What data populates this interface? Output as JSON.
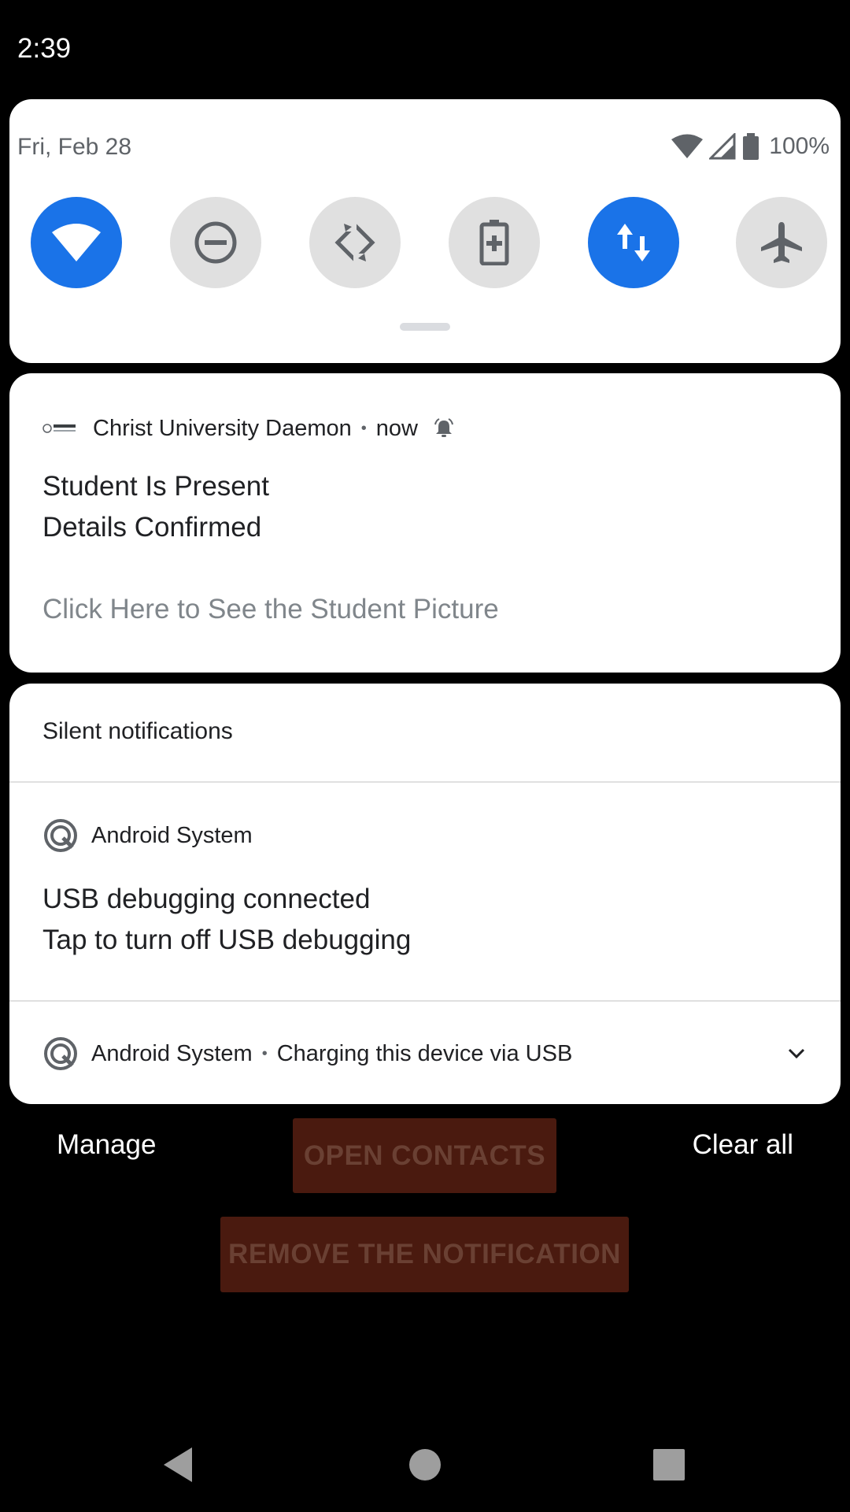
{
  "status_bar": {
    "time": "2:39"
  },
  "background_app": {
    "open_contacts_label": "OPEN CONTACTS",
    "remove_notification_label": "REMOVE THE NOTIFICATION"
  },
  "quick_settings": {
    "date": "Fri, Feb 28",
    "battery_percent": "100%",
    "tiles": [
      {
        "name": "wifi",
        "active": true
      },
      {
        "name": "do-not-disturb",
        "active": false
      },
      {
        "name": "auto-rotate",
        "active": false
      },
      {
        "name": "battery-saver",
        "active": false
      },
      {
        "name": "mobile-data",
        "active": true
      },
      {
        "name": "airplane-mode",
        "active": false
      }
    ]
  },
  "alert_notification": {
    "app_name": "Christ University Daemon",
    "time": "now",
    "title": "Student Is Present",
    "text": "Details Confirmed",
    "action": "Click Here to See the Student Picture"
  },
  "silent_section": {
    "heading": "Silent notifications",
    "items": [
      {
        "app_name": "Android System",
        "title": "USB debugging connected",
        "text": "Tap to turn off USB debugging"
      },
      {
        "app_name": "Android System",
        "summary": "Charging this device via USB"
      }
    ]
  },
  "shade_actions": {
    "manage": "Manage",
    "clear_all": "Clear all"
  },
  "colors": {
    "accent": "#1a73e8",
    "tile_off": "#e0e0e0",
    "bg_button": "#4a1a0f"
  }
}
